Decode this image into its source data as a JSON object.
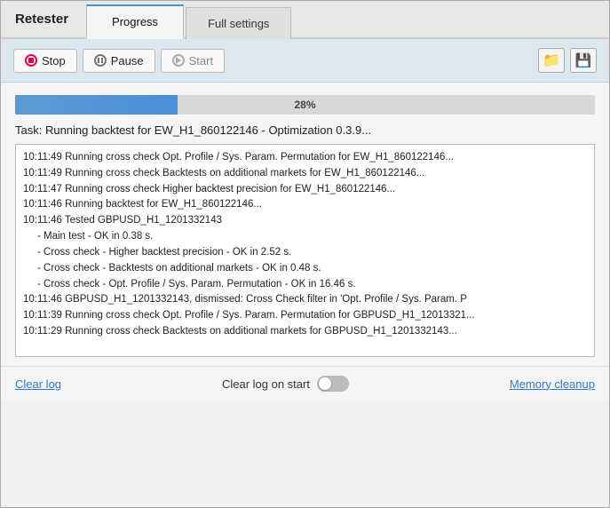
{
  "header": {
    "app_title": "Retester",
    "tabs": [
      {
        "id": "progress",
        "label": "Progress",
        "active": true
      },
      {
        "id": "full_settings",
        "label": "Full settings",
        "active": false
      }
    ]
  },
  "toolbar": {
    "stop_label": "Stop",
    "pause_label": "Pause",
    "start_label": "Start",
    "folder_icon": "📂",
    "save_icon": "💾"
  },
  "progress": {
    "percent": 28,
    "percent_label": "28%",
    "task_line": "Task: Running backtest for EW_H1_860122146 - Optimization 0.3.9..."
  },
  "log": {
    "lines": [
      {
        "text": "10:11:49 Running cross check Opt. Profile / Sys. Param. Permutation for EW_H1_860122146...",
        "indent": false
      },
      {
        "text": "10:11:49 Running cross check Backtests on additional markets for EW_H1_860122146...",
        "indent": false
      },
      {
        "text": "10:11:47 Running cross check Higher backtest precision for EW_H1_860122146...",
        "indent": false
      },
      {
        "text": "10:11:46 Running backtest for EW_H1_860122146...",
        "indent": false
      },
      {
        "text": "10:11:46 Tested GBPUSD_H1_1201332143",
        "indent": false
      },
      {
        "text": "- Main test - OK in 0.38 s.",
        "indent": true
      },
      {
        "text": "- Cross check - Higher backtest precision - OK in 2.52 s.",
        "indent": true
      },
      {
        "text": "- Cross check - Backtests on additional markets - OK in 0.48 s.",
        "indent": true
      },
      {
        "text": "- Cross check - Opt. Profile / Sys. Param. Permutation - OK in 16.46 s.",
        "indent": true
      },
      {
        "text": "10:11:46 GBPUSD_H1_1201332143, dismissed: Cross Check filter in 'Opt. Profile / Sys. Param. P",
        "indent": false
      },
      {
        "text": "10:11:39 Running cross check Opt. Profile / Sys. Param. Permutation for GBPUSD_H1_12013321...",
        "indent": false
      },
      {
        "text": "10:11:29 Running cross check Backtests on additional markets for GBPUSD_H1_1201332143...",
        "indent": false
      }
    ]
  },
  "footer": {
    "clear_log_label": "Clear log",
    "clear_log_on_start_label": "Clear log on start",
    "memory_cleanup_label": "Memory cleanup",
    "toggle_state": false
  }
}
